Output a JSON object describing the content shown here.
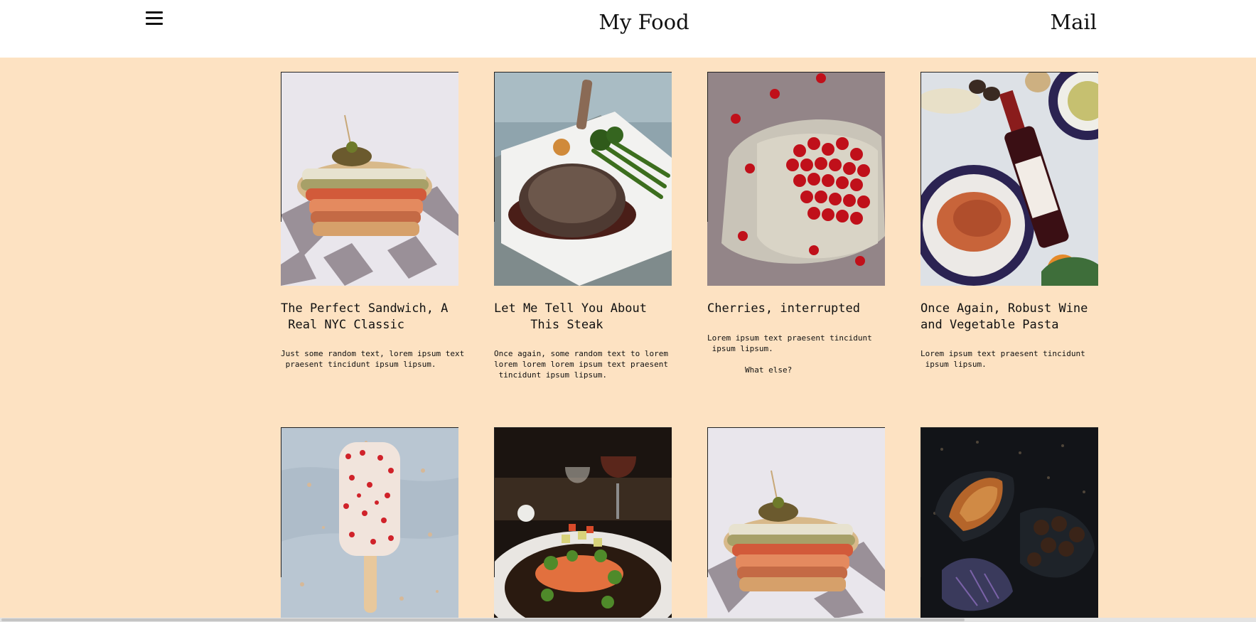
{
  "header": {
    "title": "My Food",
    "mail_label": "Mail"
  },
  "cards": [
    {
      "title": "The Perfect Sandwich, A\n Real NYC Classic",
      "text": "Just some random text, lorem ipsum text\n praesent tincidunt ipsum lipsum.",
      "image": "sandwich-photo"
    },
    {
      "title": "Let Me Tell You About\n     This Steak",
      "text": "Once again, some random text to lorem\nlorem lorem lorem ipsum text praesent\n tincidunt ipsum lipsum.",
      "image": "steak-photo"
    },
    {
      "title": "Cherries, interrupted",
      "text": "Lorem ipsum text praesent tincidunt\n ipsum lipsum.\n\n        What else?",
      "image": "cherries-photo"
    },
    {
      "title": "Once Again, Robust Wine\nand Vegetable Pasta",
      "text": "Lorem ipsum text praesent tincidunt\n ipsum lipsum.",
      "image": "wine-pasta-photo"
    },
    {
      "image": "popsicle-photo"
    },
    {
      "image": "salmon-photo"
    },
    {
      "image": "sandwich-photo"
    },
    {
      "image": "croissant-photo"
    }
  ],
  "colors": {
    "background": "#fde2c2",
    "header": "#ffffff"
  }
}
